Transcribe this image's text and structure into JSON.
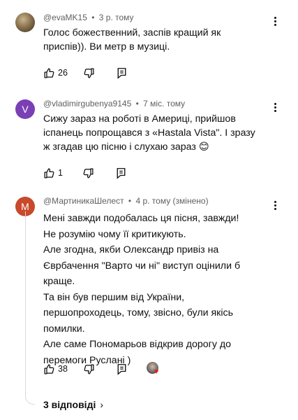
{
  "comments": [
    {
      "author": "@evaMK15",
      "time": "3 р. тому",
      "text": "Голос божественний, заспів кращий як\nприспів)). Ви метр в музиці.",
      "likes": "26"
    },
    {
      "avatar_letter": "V",
      "avatar_color": "#7b3fb5",
      "author": "@vladimirgubenya9145",
      "time": "7 міс. тому",
      "text_main": "Сижу зараз на роботі в Америці, прийшов\nіспанець попрощався з «Hastala Vista\".  І зразу\nж згадав цю пісню і слухаю зараз ",
      "emoji": "😊",
      "likes": "1"
    },
    {
      "avatar_letter": "M",
      "avatar_color": "#c8492b",
      "author": "@МартиникаШелест",
      "time": "4 р. тому (змінено)",
      "text": "Мені завжди подобалась ця пісня, завжди!\nНе розумію чому її критикують.\nАле згодна, якби Олександр привіз на\nЄврбачення \"Варто чи ні\" виступ оцінили б\nкраще.\nТа він був першим від України,\nпершопроходець, тому, звісно, були якісь\nпомилки.\nАле саме Пономарьов відкрив дорогу до\nперемоги Руслані )",
      "likes": "38",
      "replies": "3 відповіді",
      "replies_chevron": "›"
    }
  ],
  "separator": "•",
  "icons": {
    "like": "thumbs-up-icon",
    "dislike": "thumbs-down-icon",
    "reply": "reply-icon",
    "more": "more-vert-icon",
    "heart": "creator-heart-icon"
  },
  "heart_glyph": "♥"
}
